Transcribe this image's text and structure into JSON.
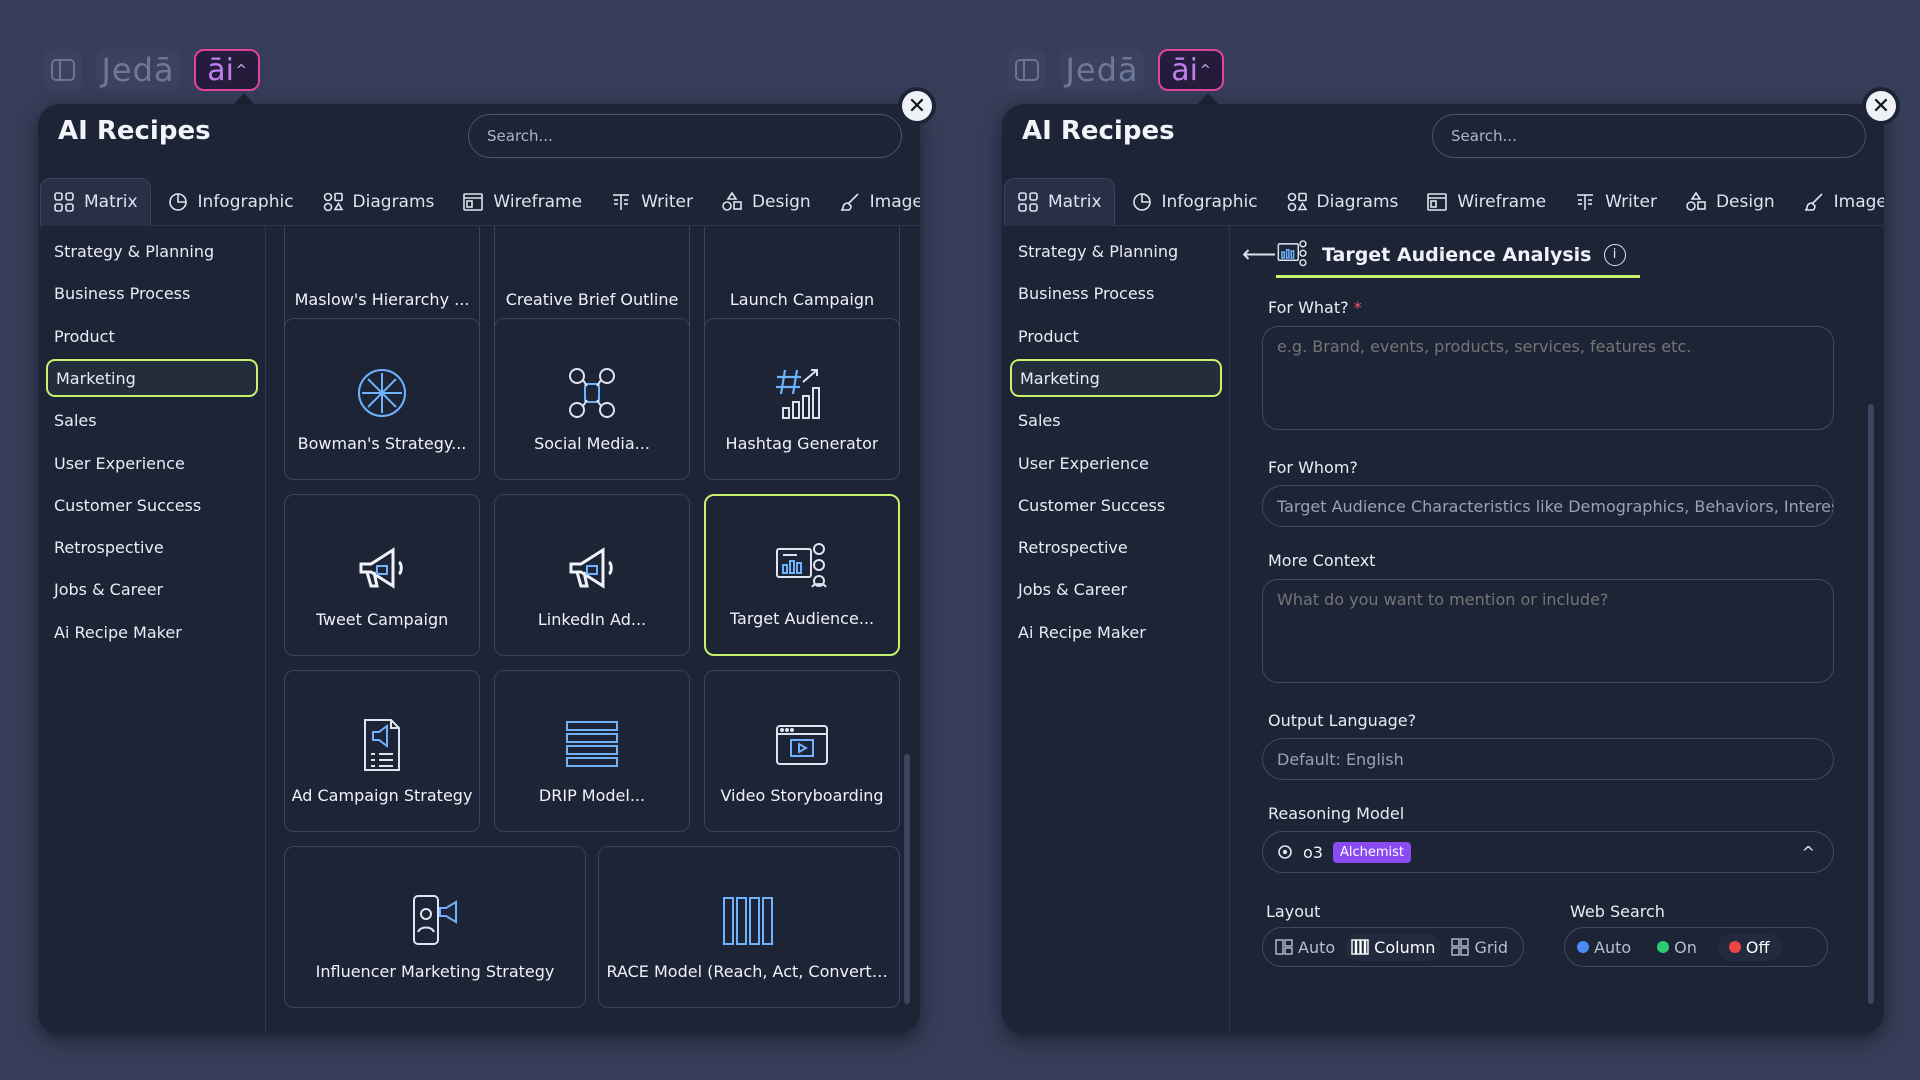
{
  "topbar": {
    "brand": "Jedā",
    "ai_label": "āi",
    "ai_caret": "^"
  },
  "panel": {
    "title": "AI Recipes",
    "search_placeholder": "Search...",
    "close_glyph": "✕",
    "tabs": [
      {
        "label": "Matrix",
        "icon": "grid-icon"
      },
      {
        "label": "Infographic",
        "icon": "pie-chart-icon"
      },
      {
        "label": "Diagrams",
        "icon": "shapes-icon"
      },
      {
        "label": "Wireframe",
        "icon": "wireframe-icon"
      },
      {
        "label": "Writer",
        "icon": "text-lines-icon"
      },
      {
        "label": "Design",
        "icon": "design-shapes-icon"
      },
      {
        "label": "Image",
        "icon": "brush-icon"
      }
    ],
    "categories": [
      "Strategy & Planning",
      "Business Process",
      "Product",
      "Marketing",
      "Sales",
      "User Experience",
      "Customer Success",
      "Retrospective",
      "Jobs & Career",
      "Ai Recipe Maker"
    ],
    "active_category": "Marketing"
  },
  "recipes": [
    {
      "label": "Maslow's Hierarchy ...",
      "icon": "pyramid-icon"
    },
    {
      "label": "Creative Brief Outline",
      "icon": "document-icon"
    },
    {
      "label": "Launch Campaign",
      "icon": "rocket-icon"
    },
    {
      "label": "Bowman's Strategy...",
      "icon": "compass-star-icon"
    },
    {
      "label": "Social Media...",
      "icon": "social-network-icon"
    },
    {
      "label": "Hashtag Generator",
      "icon": "hashtag-chart-icon"
    },
    {
      "label": "Tweet Campaign",
      "icon": "megaphone-icon"
    },
    {
      "label": "LinkedIn Ad...",
      "icon": "megaphone-icon"
    },
    {
      "label": "Target Audience...",
      "icon": "audience-chart-icon"
    },
    {
      "label": "Ad Campaign Strategy",
      "icon": "checklist-icon"
    },
    {
      "label": "DRIP Model...",
      "icon": "stacked-bars-icon"
    },
    {
      "label": "Video Storyboarding",
      "icon": "video-player-icon"
    },
    {
      "label": "Influencer Marketing Strategy",
      "icon": "influencer-icon"
    },
    {
      "label": "RACE Model (Reach, Act, Convert,...",
      "icon": "columns-icon"
    }
  ],
  "selected_recipe": "Target Audience...",
  "form": {
    "back_glyph": "⟵",
    "title": "Target Audience Analysis",
    "info_glyph": "i",
    "for_what": {
      "label": "For What?",
      "required_mark": "*",
      "placeholder": "e.g. Brand, events, products, services, features etc."
    },
    "for_whom": {
      "label": "For Whom?",
      "placeholder": "Target Audience Characteristics like Demographics, Behaviors, Interests"
    },
    "more_context": {
      "label": "More Context",
      "placeholder": "What do you want to mention or include?"
    },
    "output_language": {
      "label": "Output Language?",
      "placeholder": "Default: English"
    },
    "reasoning_model": {
      "label": "Reasoning Model",
      "value": "o3",
      "badge": "Alchemist",
      "chevron": "^"
    },
    "layout": {
      "label": "Layout",
      "options": [
        "Auto",
        "Column",
        "Grid"
      ],
      "selected": "Column"
    },
    "web_search": {
      "label": "Web Search",
      "options": [
        "Auto",
        "On",
        "Off"
      ],
      "selected": "Off",
      "dot_colors": [
        "#4a8bf5",
        "#2ecc71",
        "#ef4444"
      ]
    }
  }
}
